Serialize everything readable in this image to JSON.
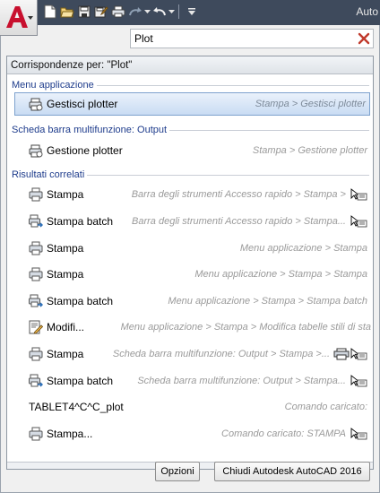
{
  "app": {
    "title_fragment": "Auto",
    "qat_icons": [
      "new-icon",
      "open-icon",
      "save-icon",
      "save-as-icon",
      "plot-icon",
      "redo-icon",
      "undo-icon",
      "customize-icon"
    ]
  },
  "search": {
    "value": "Plot",
    "placeholder": ""
  },
  "results": {
    "header": "Corrispondenze per: \"Plot\"",
    "groups": [
      {
        "label": "Menu applicazione",
        "items": [
          {
            "name": "Gestisci plotter",
            "path": "Stampa > Gestisci plotter",
            "icon": "plotter-manager-icon",
            "selected": true
          }
        ]
      },
      {
        "label": "Scheda barra multifunzione: Output",
        "items": [
          {
            "name": "Gestione plotter",
            "path": "Stampa > Gestione plotter",
            "icon": "plotter-manager-icon"
          }
        ]
      },
      {
        "label": "Risultati correlati",
        "items": [
          {
            "name": "Stampa",
            "path": "Barra degli strumenti Accesso rapido > Stampa >",
            "icon": "printer-icon",
            "pin": "cursor-list-icon"
          },
          {
            "name": "Stampa batch",
            "path": "Barra degli strumenti Accesso rapido > Stampa...",
            "icon": "batch-plot-icon",
            "pin": "cursor-list-icon"
          },
          {
            "name": "Stampa",
            "path": "Menu applicazione > Stampa",
            "icon": "printer-icon"
          },
          {
            "name": "Stampa",
            "path": "Menu applicazione > Stampa > Stampa",
            "icon": "printer-icon"
          },
          {
            "name": "Stampa batch",
            "path": "Menu applicazione > Stampa > Stampa batch",
            "icon": "batch-plot-icon"
          },
          {
            "name": "Modifi...",
            "path": "Menu applicazione > Stampa > Modifica tabelle stili di sta",
            "icon": "edit-style-icon"
          },
          {
            "name": "Stampa",
            "path": "Scheda barra multifunzione: Output > Stampa >...",
            "icon": "printer-icon",
            "pin": "cursor-list-icon",
            "pin2": "printer-small-icon"
          },
          {
            "name": "Stampa batch",
            "path": "Scheda barra multifunzione: Output > Stampa...",
            "icon": "batch-plot-icon",
            "pin": "cursor-list-icon"
          },
          {
            "name": "TABLET4^C^C_plot",
            "path": "Comando caricato:",
            "icon": ""
          },
          {
            "name": "Stampa...",
            "path": "Comando caricato: STAMPA",
            "icon": "printer-icon",
            "pin": "cursor-list-icon"
          }
        ]
      }
    ]
  },
  "buttons": {
    "options": "Opzioni",
    "close": "Chiudi Autodesk AutoCAD 2016"
  },
  "colors": {
    "group_label": "#1e3c8c",
    "selection": "#c9dcf3",
    "logo": "#c8102e"
  }
}
